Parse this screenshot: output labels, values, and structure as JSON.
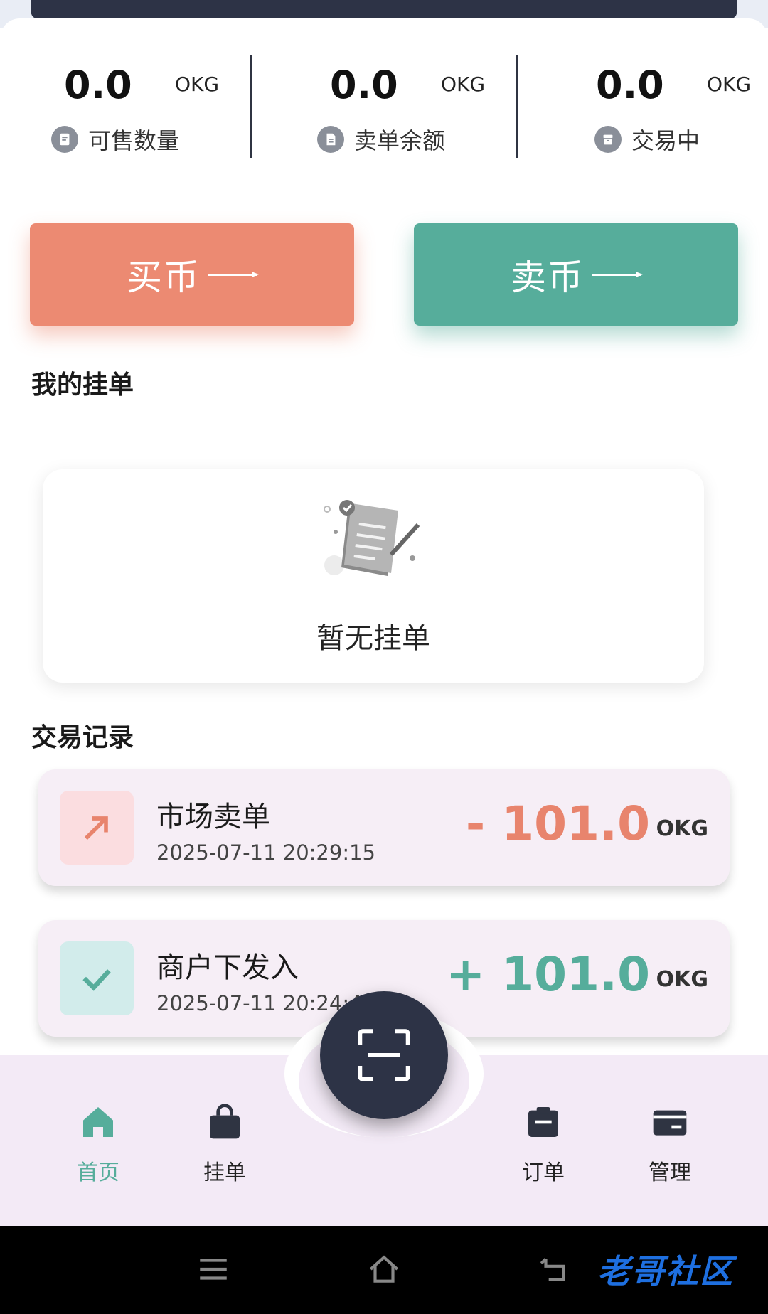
{
  "stats": [
    {
      "value": "0.0",
      "unit": "OKG",
      "label": "可售数量",
      "icon": "receipt-icon"
    },
    {
      "value": "0.0",
      "unit": "OKG",
      "label": "卖单余额",
      "icon": "document-icon"
    },
    {
      "value": "0.0",
      "unit": "OKG",
      "label": "交易中",
      "icon": "box-icon"
    }
  ],
  "actions": {
    "buy_label": "买币",
    "sell_label": "卖币"
  },
  "my_orders": {
    "title": "我的挂单",
    "empty_text": "暂无挂单"
  },
  "records": {
    "title": "交易记录",
    "items": [
      {
        "title": "市场卖单",
        "time": "2025-07-11 20:29:15",
        "amount": "- 101.0",
        "unit": "OKG",
        "icon": "arrow-up-right-icon",
        "color": "#e8846d"
      },
      {
        "title": "商户下发入",
        "time": "2025-07-11 20:24:4",
        "amount": "+ 101.0",
        "unit": "OKG",
        "icon": "check-icon",
        "color": "#56ad9b"
      }
    ]
  },
  "nav": {
    "items": [
      {
        "label": "首页",
        "icon": "home-icon",
        "active": true
      },
      {
        "label": "挂单",
        "icon": "bag-icon",
        "active": false
      },
      {
        "label": "订单",
        "icon": "clipboard-icon",
        "active": false
      },
      {
        "label": "管理",
        "icon": "card-icon",
        "active": false
      }
    ],
    "center_icon": "scan-icon"
  },
  "watermark": "老哥社区"
}
